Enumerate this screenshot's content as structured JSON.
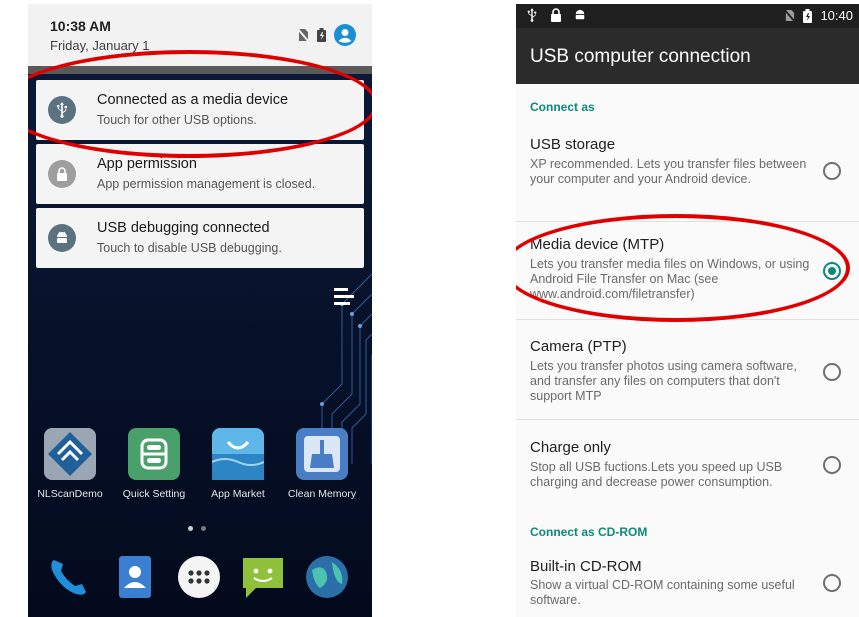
{
  "left": {
    "shade": {
      "time": "10:38 AM",
      "date": "Friday, January 1"
    },
    "notifications": [
      {
        "icon": "usb-icon",
        "title": "Connected as a media device",
        "subtitle": "Touch for other USB options.",
        "icon_color": "#5b7380"
      },
      {
        "icon": "lock-icon",
        "title": "App permission",
        "subtitle": "App permission management is closed.",
        "icon_color": "#9e9e9e"
      },
      {
        "icon": "android-icon",
        "title": "USB debugging connected",
        "subtitle": "Touch to disable USB debugging.",
        "icon_color": "#5b7380"
      }
    ],
    "apps": [
      {
        "label": "NLScanDemo",
        "icon": "nlscan-icon"
      },
      {
        "label": "Quick Setting",
        "icon": "quick-setting-icon"
      },
      {
        "label": "App Market",
        "icon": "app-market-icon"
      },
      {
        "label": "Clean Memory",
        "icon": "clean-memory-icon"
      }
    ],
    "dock": [
      "phone-icon",
      "contacts-icon",
      "app-drawer-icon",
      "messages-icon",
      "browser-icon"
    ]
  },
  "right": {
    "status_time": "10:40",
    "title": "USB computer connection",
    "sections": [
      "Connect as",
      "Connect as CD-ROM"
    ],
    "options": [
      {
        "title": "USB storage",
        "desc": "XP recommended. Lets you transfer files between your computer and your Android device.",
        "selected": false
      },
      {
        "title": "Media device (MTP)",
        "desc": "Lets you transfer media files on Windows, or using Android File Transfer on Mac (see www.android.com/filetransfer)",
        "selected": true
      },
      {
        "title": "Camera (PTP)",
        "desc": "Lets you transfer photos using camera software, and transfer any files on computers that don't support MTP",
        "selected": false
      },
      {
        "title": "Charge only",
        "desc": "Stop all USB fuctions.Lets you speed up USB charging and decrease power consumption.",
        "selected": false
      },
      {
        "title": "Built-in CD-ROM",
        "desc": "Show a virtual CD-ROM containing some useful software.",
        "selected": false
      }
    ]
  },
  "colors": {
    "accent": "#0b8a7a",
    "annotation": "#e00000"
  }
}
